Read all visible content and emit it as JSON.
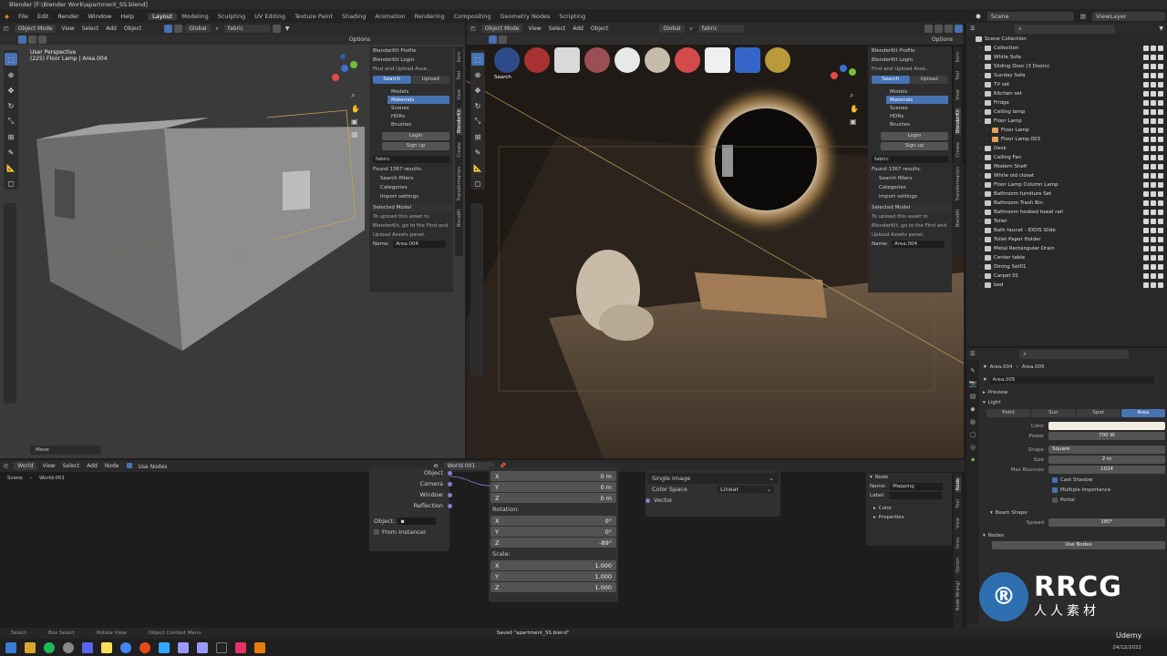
{
  "title_bar": "Blender [F:\\Blender Work\\apartment_SS.blend]",
  "menu": {
    "items": [
      "File",
      "Edit",
      "Render",
      "Window",
      "Help"
    ],
    "workspaces": [
      "Layout",
      "Modeling",
      "Sculpting",
      "UV Editing",
      "Texture Paint",
      "Shading",
      "Animation",
      "Rendering",
      "Compositing",
      "Geometry Nodes",
      "Scripting"
    ],
    "active_workspace": "Layout",
    "scene": "Scene",
    "view_layer": "ViewLayer"
  },
  "viewport_left": {
    "header": {
      "mode": "Object Mode",
      "menus": [
        "View",
        "Select",
        "Add",
        "Object"
      ],
      "orientation": "Global",
      "search": "fabric",
      "options": "Options"
    },
    "overlay_line1": "User Perspective",
    "overlay_line2": "(225) Floor Lamp | Area.004",
    "footer": "Move"
  },
  "viewport_right": {
    "header": {
      "mode": "Object Mode",
      "menus": [
        "View",
        "Select",
        "Add",
        "Object"
      ],
      "orientation": "Global",
      "search": "fabric",
      "options": "Options"
    },
    "material_text": "Search"
  },
  "blenderkit_panel": {
    "profile": "BlenderKit Profile",
    "login_header": "BlenderKit Login",
    "find_upload": "Find and Upload Asse...",
    "tabs": [
      "Search",
      "Upload"
    ],
    "asset_types": [
      "Models",
      "Materials",
      "Scenes",
      "HDRs",
      "Brushes"
    ],
    "active_asset_type": "Materials",
    "login_btn": "Login",
    "signup_btn": "Sign up",
    "search_value": "fabric",
    "results": "Found 1367 results.",
    "search_filters": "Search filters",
    "categories": "Categories",
    "import_settings": "Import settings",
    "selected_model": "Selected Model",
    "upload_line1": "To upload this asset to",
    "upload_line2": "BlenderKit, go to the Find and",
    "upload_line3": "Upload Assets panel.",
    "name_label": "Name:",
    "name_value": "Area.004",
    "side_tabs": [
      "Item",
      "Tool",
      "View",
      "BlenderKit",
      "Create",
      "Transformation",
      "BlendAI"
    ]
  },
  "outliner": {
    "root": "Scene Collection",
    "items": [
      {
        "label": "Collection",
        "depth": 0
      },
      {
        "label": "White Sofa",
        "depth": 0
      },
      {
        "label": "Sliding Door (3 Doors)",
        "depth": 0
      },
      {
        "label": "Sunday Sofa",
        "depth": 0
      },
      {
        "label": "TV set",
        "depth": 0
      },
      {
        "label": "Kitchen set",
        "depth": 0
      },
      {
        "label": "Fridge",
        "depth": 0
      },
      {
        "label": "Ceiling lamp",
        "depth": 0
      },
      {
        "label": "Floor Lamp",
        "depth": 0
      },
      {
        "label": "Floor Lamp",
        "depth": 1
      },
      {
        "label": "Floor Lamp.003",
        "depth": 1
      },
      {
        "label": "Desk",
        "depth": 0
      },
      {
        "label": "Ceiling Fan",
        "depth": 0
      },
      {
        "label": "Modern Shelf",
        "depth": 0
      },
      {
        "label": "White old closet",
        "depth": 0
      },
      {
        "label": "Floor Lamp Column Lamp",
        "depth": 0
      },
      {
        "label": "Bathroom furniture Set",
        "depth": 0
      },
      {
        "label": "Bathroom Trash Bin",
        "depth": 0
      },
      {
        "label": "Bathroom hooked towel rail",
        "depth": 0
      },
      {
        "label": "Toilet",
        "depth": 0
      },
      {
        "label": "Bath faucet - IDDIS Slide",
        "depth": 0
      },
      {
        "label": "Toilet Paper Holder",
        "depth": 0
      },
      {
        "label": "Metal Rectangular Drain",
        "depth": 0
      },
      {
        "label": "Center table",
        "depth": 0
      },
      {
        "label": "Dining Set01",
        "depth": 0
      },
      {
        "label": "Carpet 01",
        "depth": 0
      },
      {
        "label": "bed",
        "depth": 0
      }
    ]
  },
  "properties": {
    "breadcrumb_obj": "Area.004",
    "breadcrumb_data": "Area.005",
    "datablock": "Area.005",
    "preview": "Preview",
    "light": "Light",
    "light_types": [
      "Point",
      "Sun",
      "Spot",
      "Area"
    ],
    "active_light_type": "Area",
    "color_label": "Color",
    "color_value": "#f3ece3",
    "power_label": "Power",
    "power_value": "700 W",
    "shape_label": "Shape",
    "shape_value": "Square",
    "size_label": "Size",
    "size_value": "2 m",
    "max_bounces_label": "Max Bounces",
    "max_bounces_value": "1024",
    "cast_shadow": "Cast Shadow",
    "multiple_importance": "Multiple Importance",
    "portal": "Portal",
    "beam_shape": "Beam Shape",
    "spread_label": "Spread",
    "spread_value": "180°",
    "nodes": "Nodes",
    "use_nodes": "Use Nodes"
  },
  "node_editor": {
    "header": {
      "type": "World",
      "menus": [
        "View",
        "Select",
        "Add",
        "Node"
      ],
      "use_nodes": "Use Nodes",
      "world_name": "World.001"
    },
    "breadcrumb_scene": "Scene",
    "breadcrumb_world": "World.001",
    "texcoord_outputs": [
      "Object",
      "Camera",
      "Window",
      "Reflection"
    ],
    "object_label": "Object:",
    "from_instancer": "From Instancer",
    "location": [
      {
        "axis": "X",
        "value": "0 m"
      },
      {
        "axis": "Y",
        "value": "0 m"
      },
      {
        "axis": "Z",
        "value": "0 m"
      }
    ],
    "rotation_label": "Rotation:",
    "rotation": [
      {
        "axis": "X",
        "value": "0°"
      },
      {
        "axis": "Y",
        "value": "0°"
      },
      {
        "axis": "Z",
        "value": "-89°"
      }
    ],
    "scale_label": "Scale:",
    "scale": [
      {
        "axis": "X",
        "value": "1.000"
      },
      {
        "axis": "Y",
        "value": "1.000"
      },
      {
        "axis": "Z",
        "value": "1.000"
      }
    ],
    "image_mode": "Single Image",
    "color_space_label": "Color Space",
    "color_space_value": "Linear",
    "vector_label": "Vector",
    "node_panel": {
      "title": "Node",
      "name_label": "Name:",
      "name_value": "Mapping",
      "label_label": "Label:",
      "color": "Color",
      "properties": "Properties"
    },
    "side_tabs": [
      "Node",
      "Tool",
      "View",
      "Grou",
      "Option",
      "Node Wrangl"
    ]
  },
  "status": {
    "left": [
      "Select",
      "Box Select",
      "Rotate View",
      "Object Context Menu"
    ],
    "message": "Saved \"apartment_SS.blend\""
  },
  "taskbar": {
    "date": "24/12/2022"
  },
  "watermark": {
    "logo": "RRCG",
    "sub": "人人素材",
    "brand": "Udemy"
  }
}
